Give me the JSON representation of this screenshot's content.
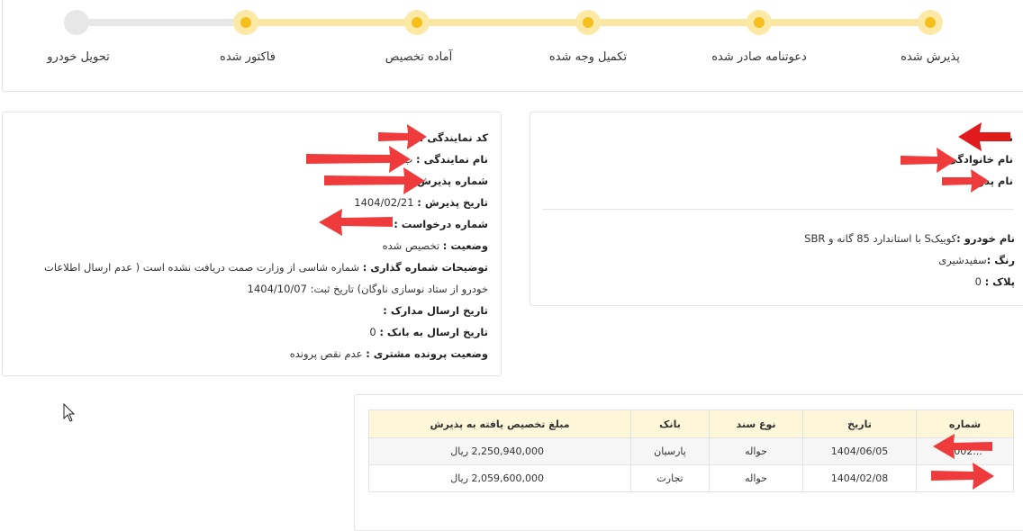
{
  "colors": {
    "accent": "#f6bf1c",
    "accent_light": "#fde9a6",
    "pending": "#e7e7e7",
    "table_header_bg": "#fdf6d9",
    "arrow": "#ef3b3b"
  },
  "stepper": {
    "steps": [
      {
        "label": "پذیرش شده",
        "done": true
      },
      {
        "label": "دعوتنامه صادر شده",
        "done": true
      },
      {
        "label": "تکمیل وجه شده",
        "done": true
      },
      {
        "label": "آماده تخصیص",
        "done": true
      },
      {
        "label": "فاکتور شده",
        "done": true
      },
      {
        "label": "تحویل خودرو",
        "done": false
      }
    ]
  },
  "customer": {
    "name_label": "نـ",
    "family_label": "نام خانوادگی",
    "father_label": "نام پدر",
    "car_name_label": "نام خودرو :",
    "car_name_value": "کوییکS با استاندارد 85 گانه و SBR",
    "color_label": "رنگ :",
    "color_value": "سفیدشیری",
    "plate_label": "پلاک :",
    "plate_value": "0"
  },
  "dealer": {
    "code_label": "کد نمایندگی :",
    "name_label": "نام نمایندگی :",
    "name_value": "ب",
    "reception_no_label": "شماره پذیرش :",
    "reception_date_label": "تاریخ پذیرش :",
    "reception_date_value": "1404/02/21",
    "request_no_label": "شماره درخواست :",
    "status_label": "وضعیت :",
    "status_value": "تخصیص شده",
    "numbering_desc_label": "توضیحات شماره گذاری :",
    "numbering_desc_value": "شماره شاسی از وزارت صمت دریافت نشده است ( عدم ارسال اطلاعات خودرو از ستاد نوسازی ناوگان) تاریخ ثبت: 1404/10/07",
    "docs_date_label": "تاریخ ارسال مدارک :",
    "bank_date_label": "تاریخ ارسال به بانک :",
    "bank_date_value": "0",
    "file_status_label": "وضعیت پرونده مشتری :",
    "file_status_value": "عدم نقص پرونده"
  },
  "payments": {
    "headers": [
      "شماره",
      "تاریخ",
      "نوع سند",
      "بانک",
      "مبلغ تخصیص یافته به پذیرش"
    ],
    "rows": [
      {
        "number": "...0002",
        "date": "1404/06/05",
        "doc_type": "حواله",
        "bank": "پارسیان",
        "amount": "2,250,940,000 ریال"
      },
      {
        "number": "",
        "date": "1404/02/08",
        "doc_type": "حواله",
        "bank": "تجارت",
        "amount": "2,059,600,000 ریال"
      }
    ]
  }
}
